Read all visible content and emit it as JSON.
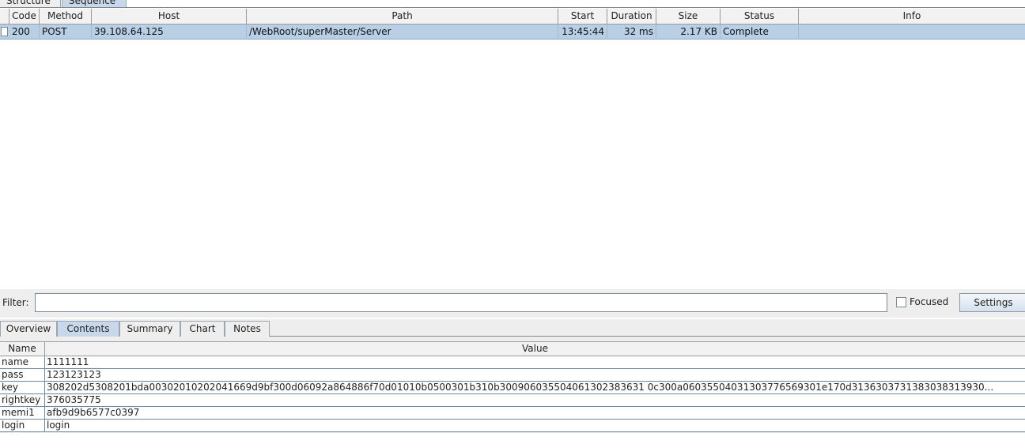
{
  "top_tabs": [
    {
      "label": "Structure"
    },
    {
      "label": "Sequence"
    }
  ],
  "request_table": {
    "columns": [
      "Code",
      "Method",
      "Host",
      "Path",
      "Start",
      "Duration",
      "Size",
      "Status",
      "Info"
    ],
    "rows": [
      {
        "code": "200",
        "method": "POST",
        "host": "39.108.64.125",
        "path": "/WebRoot/superMaster/Server",
        "start": "13:45:44",
        "duration": "32 ms",
        "size": "2.17 KB",
        "status": "Complete",
        "info": ""
      }
    ]
  },
  "filter": {
    "label": "Filter:",
    "value": "",
    "focused_label": "Focused",
    "focused_checked": false,
    "settings_label": "Settings"
  },
  "detail_tabs": [
    {
      "label": "Overview"
    },
    {
      "label": "Contents"
    },
    {
      "label": "Summary"
    },
    {
      "label": "Chart"
    },
    {
      "label": "Notes"
    }
  ],
  "contents_table": {
    "columns": [
      "Name",
      "Value"
    ],
    "rows": [
      {
        "name": "name",
        "value": "1111111"
      },
      {
        "name": "pass",
        "value": "123123123"
      },
      {
        "name": "key",
        "value": "308202d5308201bda00302010202041669d9bf300d06092a864886f70d01010b0500301b310b300906035504061302383631 0c300a06035504031303776569301e170d3136303731383038313930..."
      },
      {
        "name": "rightkey",
        "value": "376035775"
      },
      {
        "name": "memi1",
        "value": "afb9d9b6577c0397"
      },
      {
        "name": "login",
        "value": "login"
      }
    ]
  },
  "colors": {
    "selected_row": "#b8cfe5",
    "active_tab": "#c8d8ea",
    "panel_bg": "#eeeeee"
  }
}
